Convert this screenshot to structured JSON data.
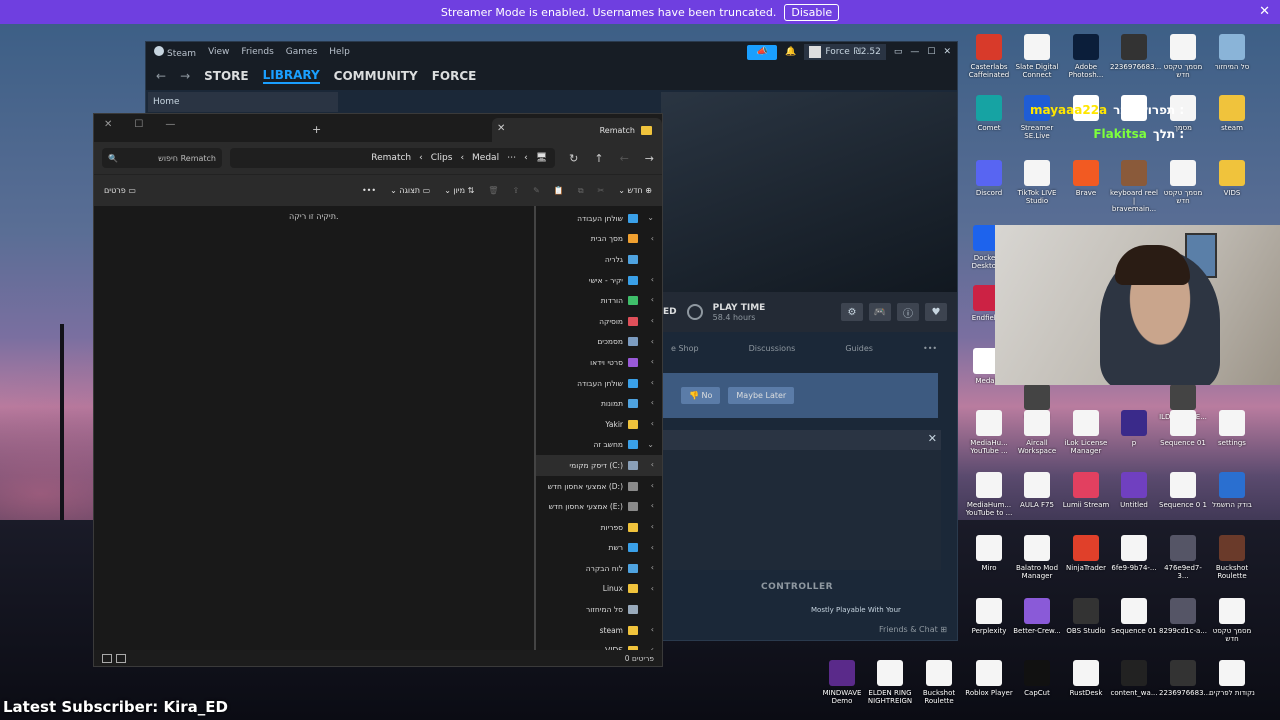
{
  "streamer_bar": {
    "message": "Streamer Mode is enabled. Usernames have been truncated.",
    "disable_label": "Disable",
    "close_glyph": "✕",
    "bg_color": "#6f3fe0"
  },
  "steam": {
    "menu": [
      "Steam",
      "View",
      "Friends",
      "Games",
      "Help"
    ],
    "nav": {
      "store": "STORE",
      "library": "LIBRARY",
      "community": "COMMUNITY",
      "profile": "FORCE"
    },
    "user": "Force",
    "balance": "₪2.52",
    "home_label": "Home",
    "play_time_label": "PLAY TIME",
    "play_time_value": "58.4 hours",
    "partial_label": "ED",
    "tabs": [
      "e Shop",
      "Discussions",
      "Guides",
      "•••"
    ],
    "prompt_no": "No",
    "prompt_later": "Maybe Later",
    "controller_label": "CONTROLLER",
    "controller_sub": "Mostly Playable With Your",
    "friends_label": "Friends & Chat",
    "accent": "#1a9fff"
  },
  "explorer": {
    "tab_title": "Rematch",
    "search_placeholder": "חיפוש Rematch",
    "breadcrumbs": [
      "Rematch",
      "Clips",
      "Medal"
    ],
    "toolbar": {
      "new_label": "חדש",
      "sort_label": "מיון",
      "view_label": "תצוגה",
      "details_label": "פרטים",
      "more": "•••"
    },
    "empty_message": "תיקיה זו ריקה.",
    "sidebar": [
      {
        "label": "שולחן העבודה",
        "color": "#3aa0e8",
        "chev": "⌄"
      },
      {
        "label": "מסך הבית",
        "color": "#f0a030",
        "chev": "‹"
      },
      {
        "label": "גלריה",
        "color": "#4fa3e0",
        "chev": ""
      },
      {
        "label": "יקיר - אישי",
        "color": "#3aa0e8",
        "chev": "‹"
      },
      {
        "label": "הורדות",
        "color": "#3fbf6a",
        "chev": "‹"
      },
      {
        "label": "מוסיקה",
        "color": "#e0505a",
        "chev": "‹"
      },
      {
        "label": "מסמכים",
        "color": "#7c9cc0",
        "chev": "‹"
      },
      {
        "label": "סרטי וידאו",
        "color": "#9a5ad8",
        "chev": "‹"
      },
      {
        "label": "שולחן העבודה",
        "color": "#3aa0e8",
        "chev": "‹"
      },
      {
        "label": "תמונות",
        "color": "#4fa3e0",
        "chev": "‹"
      },
      {
        "label": "Yakir",
        "color": "#f0c33c",
        "chev": "‹"
      },
      {
        "label": "מחשב זה",
        "color": "#3aa0e8",
        "chev": "⌄"
      },
      {
        "label": "דיסק מקומי (C:)",
        "color": "#8aa0b8",
        "chev": "‹",
        "selected": true
      },
      {
        "label": "אמצעי אחסון חדש (D:)",
        "color": "#8a8a8a",
        "chev": "‹"
      },
      {
        "label": "אמצעי אחסון חדש (E:)",
        "color": "#8a8a8a",
        "chev": "‹"
      },
      {
        "label": "ספריות",
        "color": "#f0c33c",
        "chev": "‹"
      },
      {
        "label": "רשת",
        "color": "#3aa0e8",
        "chev": "‹"
      },
      {
        "label": "לוח הבקרה",
        "color": "#4fa3e0",
        "chev": "‹"
      },
      {
        "label": "Linux",
        "color": "#f0c33c",
        "chev": "‹"
      },
      {
        "label": "סל המיחזור",
        "color": "#9ab",
        "chev": ""
      },
      {
        "label": "steam",
        "color": "#f0c33c",
        "chev": "‹"
      },
      {
        "label": "VIDS",
        "color": "#f0c33c",
        "chev": "‹"
      }
    ],
    "status_count": "0 פריטים"
  },
  "chat": [
    {
      "user": "mayaaa22a",
      "text": "תפרוש כבר :"
    },
    {
      "user": "Flakitsa",
      "text": "תלך :"
    }
  ],
  "desktop_icons": [
    {
      "label": "Casterlabs Caffeinated",
      "color": "#d83a2a"
    },
    {
      "label": "Slate Digital Connect",
      "color": "#f5f5f5"
    },
    {
      "label": "Adobe Photosh...",
      "color": "#0b1e3a"
    },
    {
      "label": "2236976683...",
      "color": "#333"
    },
    {
      "label": "מסמך טקסט חדש",
      "color": "#f5f5f5"
    },
    {
      "label": "סל המיחזור",
      "color": "#8ab4d8"
    },
    {
      "label": "Comet",
      "color": "#16a3a3"
    },
    {
      "label": "Streamer SE.Live",
      "color": "#1f5dd6"
    },
    {
      "label": "",
      "color": "#ffffff"
    },
    {
      "label": "",
      "color": "#ffffff"
    },
    {
      "label": "מסמך",
      "color": "#f5f5f5"
    },
    {
      "label": "steam",
      "color": "#f0c33c"
    },
    {
      "label": "Discord",
      "color": "#5865f2"
    },
    {
      "label": "TikTok LIVE Studio",
      "color": "#f5f5f5"
    },
    {
      "label": "Brave",
      "color": "#f25a22"
    },
    {
      "label": "keyboard reel | bravemain...",
      "color": "#8a5a3a"
    },
    {
      "label": "מסמך טקסט חדש",
      "color": "#f5f5f5"
    },
    {
      "label": "VIDS",
      "color": "#f0c33c"
    },
    {
      "label": "Docker Desktop",
      "color": "#1d63ed"
    },
    {
      "label": "Endfield",
      "color": "#cc2244"
    },
    {
      "label": "Medal",
      "color": "#ffffff"
    },
    {
      "label": "Central",
      "color": "#444"
    },
    {
      "label": "ILDMLFY RE...",
      "color": "#444"
    },
    {
      "label": "MediaHu... YouTube ...",
      "color": "#f5f5f5"
    },
    {
      "label": "Aircall Workspace",
      "color": "#f5f5f5"
    },
    {
      "label": "iLok License Manager",
      "color": "#f5f5f5"
    },
    {
      "label": "p",
      "color": "#3a2a8a"
    },
    {
      "label": "Sequence 01",
      "color": "#f5f5f5"
    },
    {
      "label": "settings",
      "color": "#f5f5f5"
    },
    {
      "label": "MediaHum... YouTube to ...",
      "color": "#f5f5f5"
    },
    {
      "label": "AULA F75",
      "color": "#f5f5f5"
    },
    {
      "label": "Lumii Stream",
      "color": "#e24060"
    },
    {
      "label": "Untitled",
      "color": "#7040c0"
    },
    {
      "label": "Sequence 0 1",
      "color": "#f5f5f5"
    },
    {
      "label": "בודק החשמל",
      "color": "#2a6fd0"
    },
    {
      "label": "Miro",
      "color": "#f5f5f5"
    },
    {
      "label": "Balatro Mod Manager",
      "color": "#f5f5f5"
    },
    {
      "label": "NinjaTrader",
      "color": "#e0402a"
    },
    {
      "label": "6fe9-9b74-...",
      "color": "#f5f5f5"
    },
    {
      "label": "476e9ed7-3...",
      "color": "#556"
    },
    {
      "label": "Buckshot Roulette",
      "color": "#6a3a2a"
    },
    {
      "label": "Perplexity",
      "color": "#f5f5f5"
    },
    {
      "label": "Better-Crew...",
      "color": "#8a5ad8"
    },
    {
      "label": "OBS Studio",
      "color": "#333"
    },
    {
      "label": "Sequence 01",
      "color": "#f5f5f5"
    },
    {
      "label": "8299cd1c-a...",
      "color": "#556"
    },
    {
      "label": "מסמך טקסט חדש",
      "color": "#f5f5f5"
    },
    {
      "label": "MINDWAVE Demo",
      "color": "#5a2a8a"
    },
    {
      "label": "ELDEN RING NIGHTREIGN",
      "color": "#f5f5f5"
    },
    {
      "label": "Buckshot Roulette",
      "color": "#f5f5f5"
    },
    {
      "label": "Roblox Player",
      "color": "#f5f5f5"
    },
    {
      "label": "CapCut",
      "color": "#111"
    },
    {
      "label": "RustDesk",
      "color": "#f5f5f5"
    },
    {
      "label": "content_wa...",
      "color": "#222"
    },
    {
      "label": "2236976683...",
      "color": "#333"
    },
    {
      "label": "נקודות לפרקים",
      "color": "#f5f5f5"
    }
  ],
  "latest_subscriber": "Latest Subscriber: Kira_ED"
}
